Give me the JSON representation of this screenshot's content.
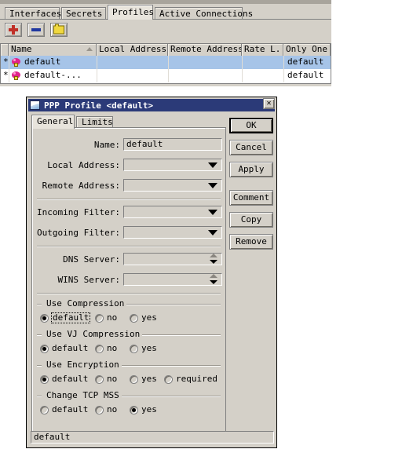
{
  "main_window": {
    "tabs": [
      {
        "label": "Interfaces",
        "active": false
      },
      {
        "label": "Secrets",
        "active": false
      },
      {
        "label": "Profiles",
        "active": true
      },
      {
        "label": "Active Connections",
        "active": false
      }
    ],
    "toolbar": [
      {
        "name": "add-button",
        "icon": "plus-icon"
      },
      {
        "name": "remove-button",
        "icon": "minus-icon"
      },
      {
        "name": "comment-button",
        "icon": "folder-icon"
      }
    ],
    "list": {
      "columns": [
        "",
        "Name",
        "Local Address",
        "Remote Address",
        "Rate L...",
        "Only One"
      ],
      "sort_column": "Name",
      "rows": [
        {
          "flag": "*",
          "name": "default",
          "local_address": "",
          "remote_address": "",
          "rate_limit": "",
          "only_one": "default",
          "selected": true
        },
        {
          "flag": "*",
          "name": "default-...",
          "local_address": "",
          "remote_address": "",
          "rate_limit": "",
          "only_one": "default",
          "selected": false
        }
      ]
    }
  },
  "dialog": {
    "title": "PPP Profile <default>",
    "close_label": "✕",
    "tabs": [
      {
        "label": "General",
        "active": true
      },
      {
        "label": "Limits",
        "active": false
      }
    ],
    "fields": {
      "name_label": "Name:",
      "name_value": "default",
      "local_address_label": "Local Address:",
      "local_address_value": "",
      "remote_address_label": "Remote Address:",
      "remote_address_value": "",
      "incoming_filter_label": "Incoming Filter:",
      "incoming_filter_value": "",
      "outgoing_filter_label": "Outgoing Filter:",
      "outgoing_filter_value": "",
      "dns_server_label": "DNS Server:",
      "dns_server_value": "",
      "wins_server_label": "WINS Server:",
      "wins_server_value": ""
    },
    "groups": [
      {
        "title": "Use Compression",
        "options": [
          {
            "label": "default",
            "selected": true,
            "focused": true
          },
          {
            "label": "no",
            "selected": false,
            "focused": false
          },
          {
            "label": "yes",
            "selected": false,
            "focused": false
          }
        ]
      },
      {
        "title": "Use VJ Compression",
        "options": [
          {
            "label": "default",
            "selected": true,
            "focused": false
          },
          {
            "label": "no",
            "selected": false,
            "focused": false
          },
          {
            "label": "yes",
            "selected": false,
            "focused": false
          }
        ]
      },
      {
        "title": "Use Encryption",
        "options": [
          {
            "label": "default",
            "selected": true,
            "focused": false
          },
          {
            "label": "no",
            "selected": false,
            "focused": false
          },
          {
            "label": "yes",
            "selected": false,
            "focused": false
          },
          {
            "label": "required",
            "selected": false,
            "focused": false
          }
        ]
      },
      {
        "title": "Change TCP MSS",
        "options": [
          {
            "label": "default",
            "selected": false,
            "focused": false
          },
          {
            "label": "no",
            "selected": false,
            "focused": false
          },
          {
            "label": "yes",
            "selected": true,
            "focused": false
          }
        ]
      }
    ],
    "buttons": [
      {
        "label": "OK",
        "default": true
      },
      {
        "label": "Cancel",
        "default": false
      },
      {
        "label": "Apply",
        "default": false
      },
      {
        "label": "Comment",
        "default": false
      },
      {
        "label": "Copy",
        "default": false
      },
      {
        "label": "Remove",
        "default": false
      }
    ],
    "status_text": "default"
  },
  "colors": {
    "window_face": "#d4d0c8",
    "titlebar": "#2b3a78",
    "selection": "#a6c4e8",
    "plus_icon": "#c03028",
    "minus_icon": "#2038a0",
    "folder_icon": "#f0d840",
    "ppp_icon": "#e0248c"
  }
}
